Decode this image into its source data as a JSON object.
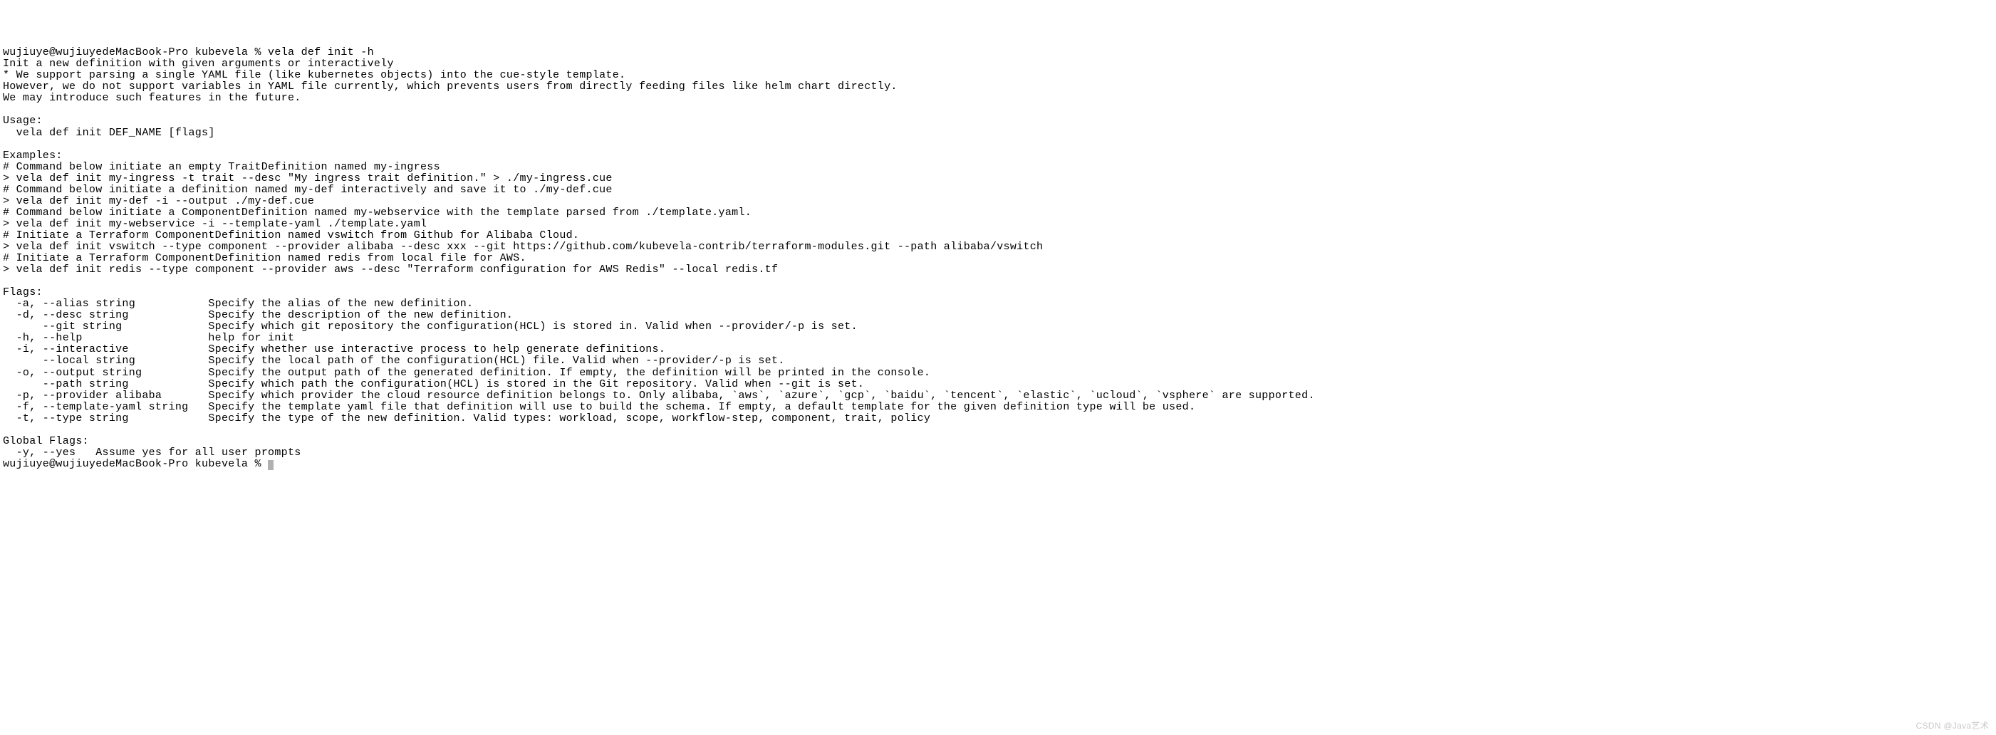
{
  "prompt1": "wujiuye@wujiuyedeMacBook-Pro kubevela % vela def init -h",
  "intro": {
    "l1": "Init a new definition with given arguments or interactively",
    "l2": "* We support parsing a single YAML file (like kubernetes objects) into the cue-style template.",
    "l3": "However, we do not support variables in YAML file currently, which prevents users from directly feeding files like helm chart directly.",
    "l4": "We may introduce such features in the future."
  },
  "usage": {
    "header": "Usage:",
    "line": "  vela def init DEF_NAME [flags]"
  },
  "examples": {
    "header": "Examples:",
    "l1": "# Command below initiate an empty TraitDefinition named my-ingress",
    "l2": "> vela def init my-ingress -t trait --desc \"My ingress trait definition.\" > ./my-ingress.cue",
    "l3": "# Command below initiate a definition named my-def interactively and save it to ./my-def.cue",
    "l4": "> vela def init my-def -i --output ./my-def.cue",
    "l5": "# Command below initiate a ComponentDefinition named my-webservice with the template parsed from ./template.yaml.",
    "l6": "> vela def init my-webservice -i --template-yaml ./template.yaml",
    "l7": "# Initiate a Terraform ComponentDefinition named vswitch from Github for Alibaba Cloud.",
    "l8": "> vela def init vswitch --type component --provider alibaba --desc xxx --git https://github.com/kubevela-contrib/terraform-modules.git --path alibaba/vswitch",
    "l9": "# Initiate a Terraform ComponentDefinition named redis from local file for AWS.",
    "l10": "> vela def init redis --type component --provider aws --desc \"Terraform configuration for AWS Redis\" --local redis.tf"
  },
  "flags": {
    "header": "Flags:",
    "f1": "  -a, --alias string           Specify the alias of the new definition.",
    "f2": "  -d, --desc string            Specify the description of the new definition.",
    "f3": "      --git string             Specify which git repository the configuration(HCL) is stored in. Valid when --provider/-p is set.",
    "f4": "  -h, --help                   help for init",
    "f5": "  -i, --interactive            Specify whether use interactive process to help generate definitions.",
    "f6": "      --local string           Specify the local path of the configuration(HCL) file. Valid when --provider/-p is set.",
    "f7": "  -o, --output string          Specify the output path of the generated definition. If empty, the definition will be printed in the console.",
    "f8": "      --path string            Specify which path the configuration(HCL) is stored in the Git repository. Valid when --git is set.",
    "f9": "  -p, --provider alibaba       Specify which provider the cloud resource definition belongs to. Only alibaba, `aws`, `azure`, `gcp`, `baidu`, `tencent`, `elastic`, `ucloud`, `vsphere` are supported.",
    "f10": "  -f, --template-yaml string   Specify the template yaml file that definition will use to build the schema. If empty, a default template for the given definition type will be used.",
    "f11": "  -t, --type string            Specify the type of the new definition. Valid types: workload, scope, workflow-step, component, trait, policy"
  },
  "global": {
    "header": "Global Flags:",
    "g1": "  -y, --yes   Assume yes for all user prompts"
  },
  "prompt2": "wujiuye@wujiuyedeMacBook-Pro kubevela % ",
  "watermark": "CSDN @Java艺术"
}
